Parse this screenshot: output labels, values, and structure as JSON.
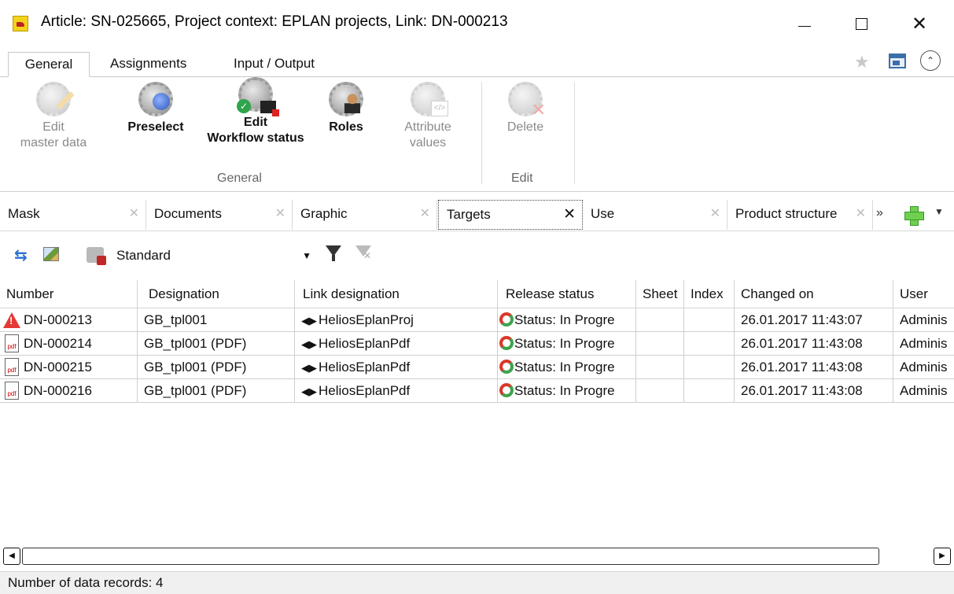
{
  "window": {
    "title": "Article: SN-025665, Project context: EPLAN projects, Link: DN-000213"
  },
  "ribbon": {
    "tabs": [
      "General",
      "Assignments",
      "Input / Output"
    ],
    "active_tab": "General",
    "buttons": {
      "edit_master_data": {
        "line1": "Edit",
        "line2": "master data",
        "enabled": false
      },
      "preselect": {
        "line1": "Preselect",
        "line2": "",
        "enabled": true
      },
      "edit_workflow": {
        "line1": "Edit",
        "line2": "Workflow status",
        "enabled": true
      },
      "roles": {
        "line1": "Roles",
        "line2": "",
        "enabled": true
      },
      "attribute_values": {
        "line1": "Attribute",
        "line2": "values",
        "enabled": false
      },
      "delete": {
        "line1": "Delete",
        "line2": "",
        "enabled": false
      }
    },
    "groups": {
      "general": "General",
      "edit": "Edit"
    }
  },
  "doc_tabs": {
    "items": [
      "Mask",
      "Documents",
      "Graphic",
      "Targets",
      "Use",
      "Product structure"
    ],
    "active": "Targets",
    "more": "»"
  },
  "toolbar": {
    "view_select": "Standard"
  },
  "grid": {
    "columns": [
      "Number",
      "Designation",
      "Link designation",
      "Release status",
      "Sheet",
      "Index",
      "Changed on",
      "User"
    ],
    "rows": [
      {
        "icon": "warning-icon",
        "number": "DN-000213",
        "designation": "GB_tpl001",
        "link": "HeliosEplanProj",
        "status": "Status: In Progre",
        "sheet": "",
        "index": "",
        "changed": "26.01.2017 11:43:07",
        "user": "Adminis"
      },
      {
        "icon": "pdf-icon",
        "number": "DN-000214",
        "designation": "GB_tpl001 (PDF)",
        "link": "HeliosEplanPdf",
        "status": "Status: In Progre",
        "sheet": "",
        "index": "",
        "changed": "26.01.2017 11:43:08",
        "user": "Adminis"
      },
      {
        "icon": "pdf-icon",
        "number": "DN-000215",
        "designation": "GB_tpl001 (PDF)",
        "link": "HeliosEplanPdf",
        "status": "Status: In Progre",
        "sheet": "",
        "index": "",
        "changed": "26.01.2017 11:43:08",
        "user": "Adminis"
      },
      {
        "icon": "pdf-icon",
        "number": "DN-000216",
        "designation": "GB_tpl001 (PDF)",
        "link": "HeliosEplanPdf",
        "status": "Status: In Progre",
        "sheet": "",
        "index": "",
        "changed": "26.01.2017 11:43:08",
        "user": "Adminis"
      }
    ]
  },
  "status_bar": {
    "text": "Number of data records: 4"
  }
}
